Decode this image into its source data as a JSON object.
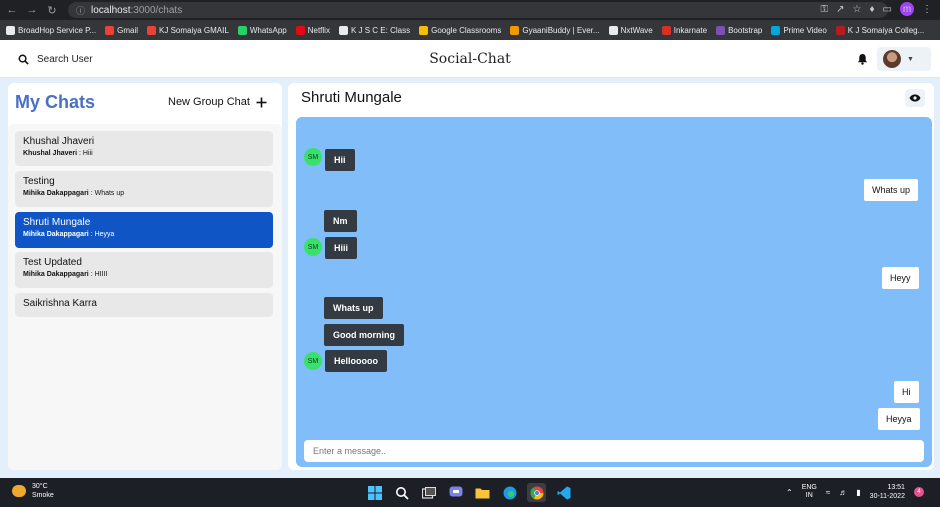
{
  "browser": {
    "url_host": "localhost",
    "url_path": ":3000/chats",
    "profile_initial": "m",
    "bookmarks": [
      {
        "label": "BroadHop Service P...",
        "color": "#e8eaed"
      },
      {
        "label": "Gmail",
        "color": "#ea4335"
      },
      {
        "label": "KJ Somaiya GMAIL",
        "color": "#ea4335"
      },
      {
        "label": "WhatsApp",
        "color": "#25d366"
      },
      {
        "label": "Netflix",
        "color": "#e50914"
      },
      {
        "label": "K J S C E: Class",
        "color": "#e8eaed"
      },
      {
        "label": "Google Classrooms",
        "color": "#fbbc04"
      },
      {
        "label": "GyaaniBuddy | Ever...",
        "color": "#f29900"
      },
      {
        "label": "NxtWave",
        "color": "#e8eaed"
      },
      {
        "label": "Inkarnate",
        "color": "#d93025"
      },
      {
        "label": "Bootstrap",
        "color": "#7952b3"
      },
      {
        "label": "Prime Video",
        "color": "#00a8e1"
      },
      {
        "label": "K J Somaiya Colleg...",
        "color": "#b71c1c"
      }
    ]
  },
  "header": {
    "search_label": "Search User",
    "title": "Social-Chat"
  },
  "sidebar": {
    "title": "My Chats",
    "new_group_label": "New Group Chat",
    "chats": [
      {
        "name": "Khushal Jhaveri",
        "sender": "Khushal Jhaveri",
        "message": "Hiii"
      },
      {
        "name": "Testing",
        "sender": "Mihika Dakappagari",
        "message": "Whats up"
      },
      {
        "name": "Shruti Mungale",
        "sender": "Mihika Dakappagari",
        "message": "Heyya"
      },
      {
        "name": "Test Updated",
        "sender": "Mihika Dakappagari",
        "message": "HIIII"
      },
      {
        "name": "Saikrishna Karra"
      }
    ]
  },
  "chat": {
    "title": "Shruti Mungale",
    "avatar_initials": "SM",
    "messages": [
      {
        "text": "Hii"
      },
      {
        "text": "Whats up"
      },
      {
        "text": "Nm"
      },
      {
        "text": "Hiii"
      },
      {
        "text": "Heyy"
      },
      {
        "text": "Whats up"
      },
      {
        "text": "Good morning"
      },
      {
        "text": "Hellooooo"
      },
      {
        "text": "Hi"
      },
      {
        "text": "Heyya"
      }
    ],
    "input_placeholder": "Enter a message.."
  },
  "taskbar": {
    "temperature": "30°C",
    "weather": "Smoke",
    "lang_top": "ENG",
    "lang_bottom": "IN",
    "time": "13:51",
    "date": "30-11-2022",
    "notification_count": "4"
  },
  "colors": {
    "accent": "#4a6fc4",
    "active_chat": "#0f55c6",
    "message_area": "#80bdf9",
    "incoming_bubble": "#333a42",
    "avatar_green": "#3be06c"
  }
}
